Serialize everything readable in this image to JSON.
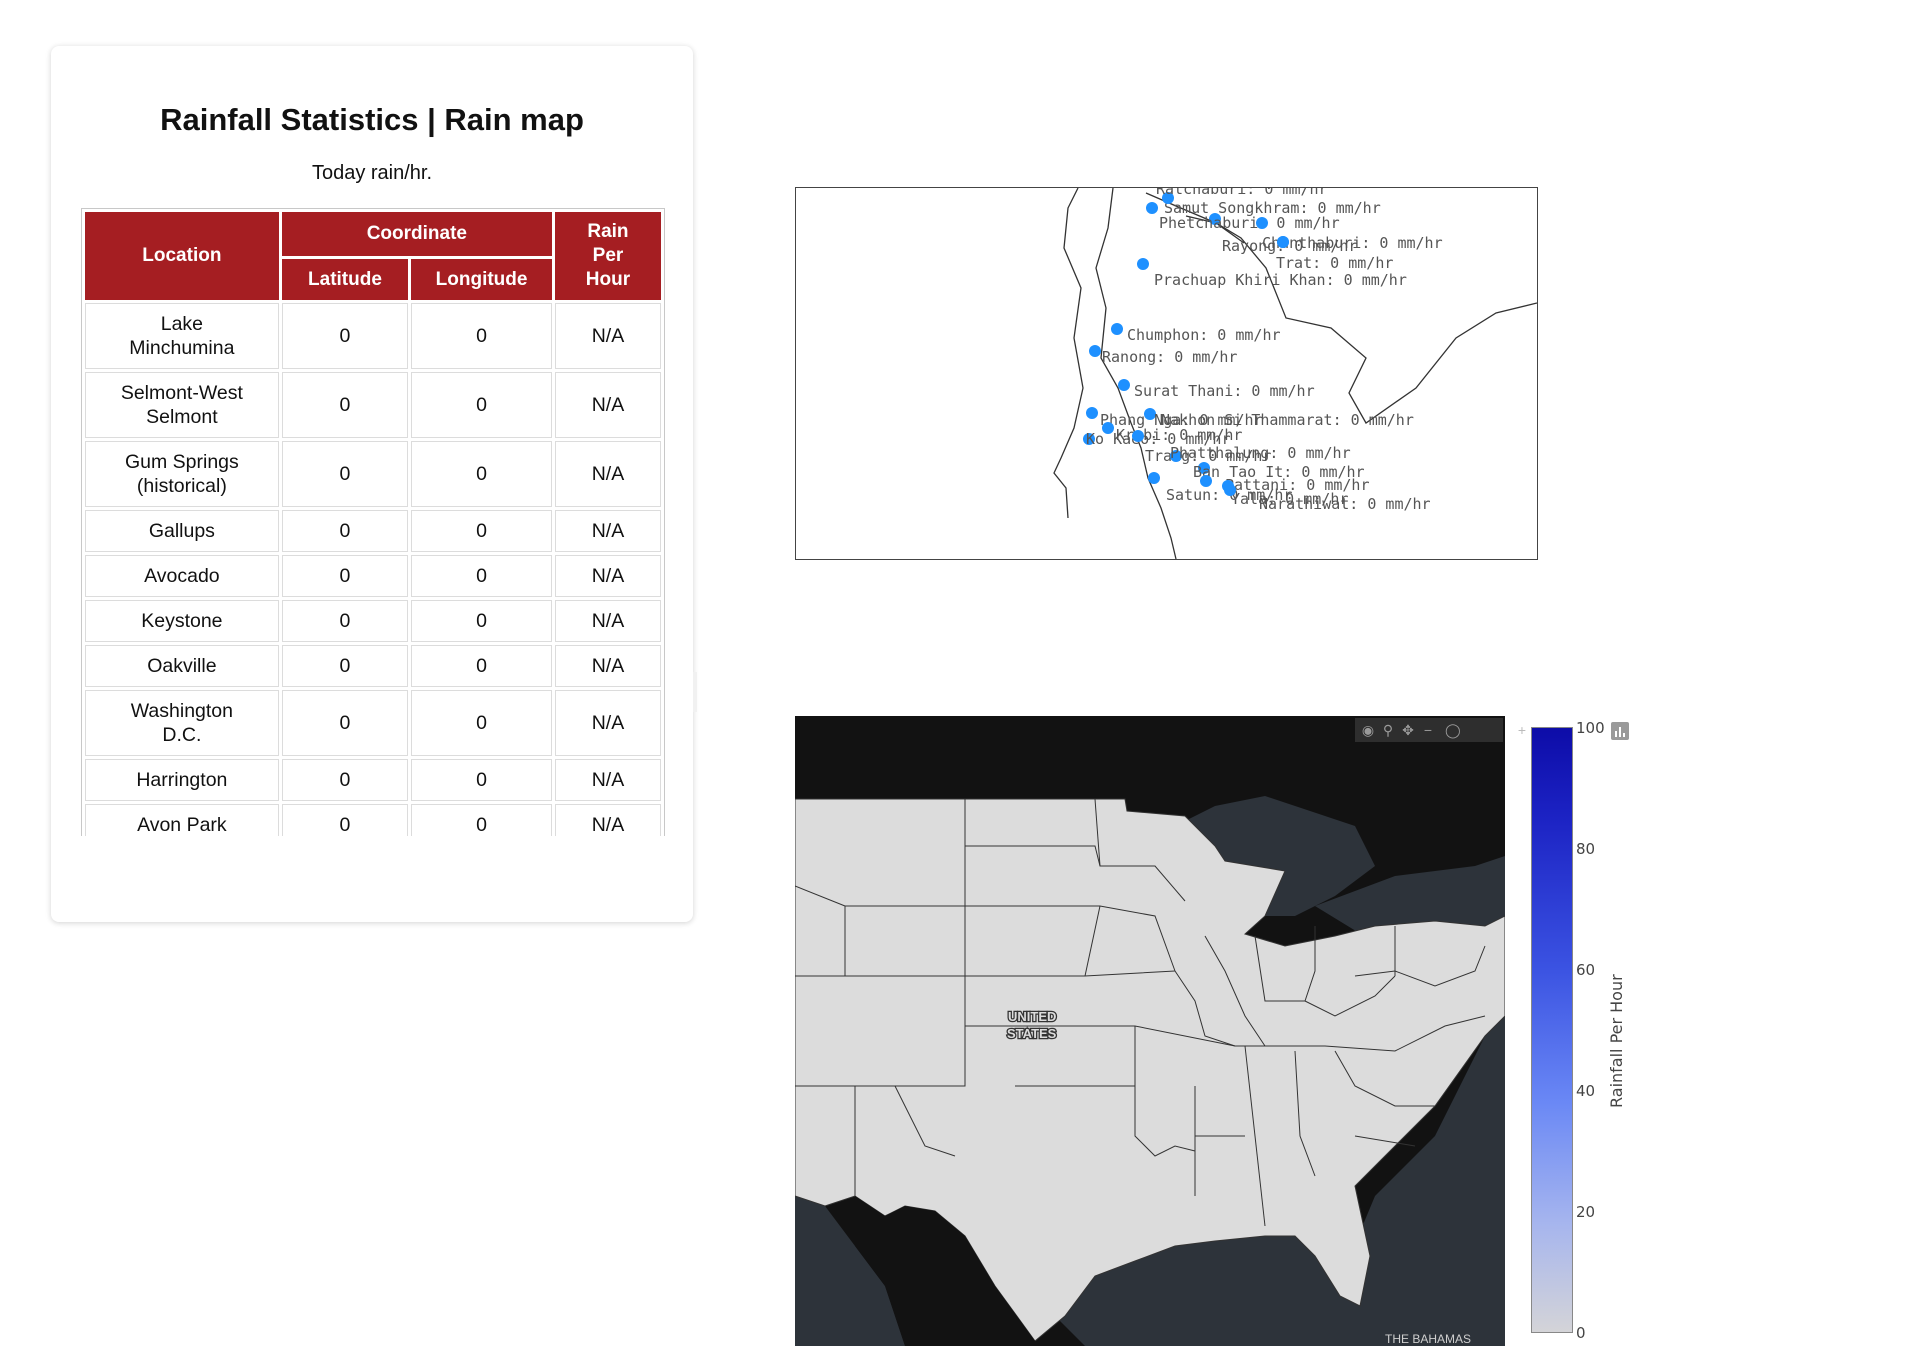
{
  "stats": {
    "title": "Rainfall Statistics | Rain map",
    "subtitle": "Today rain/hr.",
    "headers": {
      "location": "Location",
      "coordinate": "Coordinate",
      "latitude": "Latitude",
      "longitude": "Longitude",
      "rain_line1": "Rain",
      "rain_line2": "Per",
      "rain_line3": "Hour"
    },
    "rows": [
      {
        "location": "Lake Minchumina",
        "lat": "0",
        "lon": "0",
        "rain": "N/A"
      },
      {
        "location": "Selmont-West Selmont",
        "lat": "0",
        "lon": "0",
        "rain": "N/A"
      },
      {
        "location": "Gum Springs (historical)",
        "lat": "0",
        "lon": "0",
        "rain": "N/A"
      },
      {
        "location": "Gallups",
        "lat": "0",
        "lon": "0",
        "rain": "N/A"
      },
      {
        "location": "Avocado",
        "lat": "0",
        "lon": "0",
        "rain": "N/A"
      },
      {
        "location": "Keystone",
        "lat": "0",
        "lon": "0",
        "rain": "N/A"
      },
      {
        "location": "Oakville",
        "lat": "0",
        "lon": "0",
        "rain": "N/A"
      },
      {
        "location": "Washington D.C.",
        "lat": "0",
        "lon": "0",
        "rain": "N/A"
      },
      {
        "location": "Harrington",
        "lat": "0",
        "lon": "0",
        "rain": "N/A"
      },
      {
        "location": "Avon Park",
        "lat": "0",
        "lon": "0",
        "rain": "N/A"
      }
    ]
  },
  "thai_map": {
    "marker_color": "#1e90ff",
    "points": [
      {
        "label": "Phetchaburi: 0 mm/hr"
      },
      {
        "label": "Rayong: 0 mm/hr"
      },
      {
        "label": "Chanthaburi: 0 mm/hr"
      },
      {
        "label": "Trat: 0 mm/hr"
      },
      {
        "label": "Prachuap Khiri Khan: 0 mm/hr"
      },
      {
        "label": "Chumphon: 0 mm/hr"
      },
      {
        "label": "Ranong: 0 mm/hr"
      },
      {
        "label": "Surat Thani: 0 mm/hr"
      },
      {
        "label": "Nakhon Si Thammarat: 0 mm/hr"
      },
      {
        "label": "Phang Nga: 0 mm/hr"
      },
      {
        "label": "Krabi: 0 mm/hr"
      },
      {
        "label": "Ko Kaeo: 0 mm/hr"
      },
      {
        "label": "Trang: 0 mm/hr"
      },
      {
        "label": "Phatthalung: 0 mm/hr"
      },
      {
        "label": "Ban Tao It: 0 mm/hr"
      },
      {
        "label": "Pattani: 0 mm/hr"
      },
      {
        "label": "Satun: 0 mm/hr"
      },
      {
        "label": "Yala: 0 mm/hr"
      },
      {
        "label": "Narathiwat: 0 mm/hr"
      },
      {
        "label": "Samut Songkhram: 0 mm/hr"
      },
      {
        "label": "Ratchaburi: 0 mm/hr"
      }
    ]
  },
  "us_map": {
    "country_label_1": "UNITED",
    "country_label_2": "STATES",
    "place_label": "THE BAHAMAS",
    "land_color": "#dcdcdc",
    "water_color": "#2d333a",
    "dark_color": "#121212",
    "modebar_icons": [
      "camera-icon",
      "zoom-icon",
      "pan-icon",
      "lasso-icon",
      "zoom-in-icon",
      "zoom-out-icon",
      "reset-icon"
    ],
    "colorbar": {
      "title": "Rainfall Per Hour",
      "ticks": [
        "100",
        "80",
        "60",
        "40",
        "20",
        "0"
      ],
      "max": 100,
      "min": 0,
      "color_high": "#0d0ca8",
      "color_low": "#d4d4d8"
    }
  }
}
